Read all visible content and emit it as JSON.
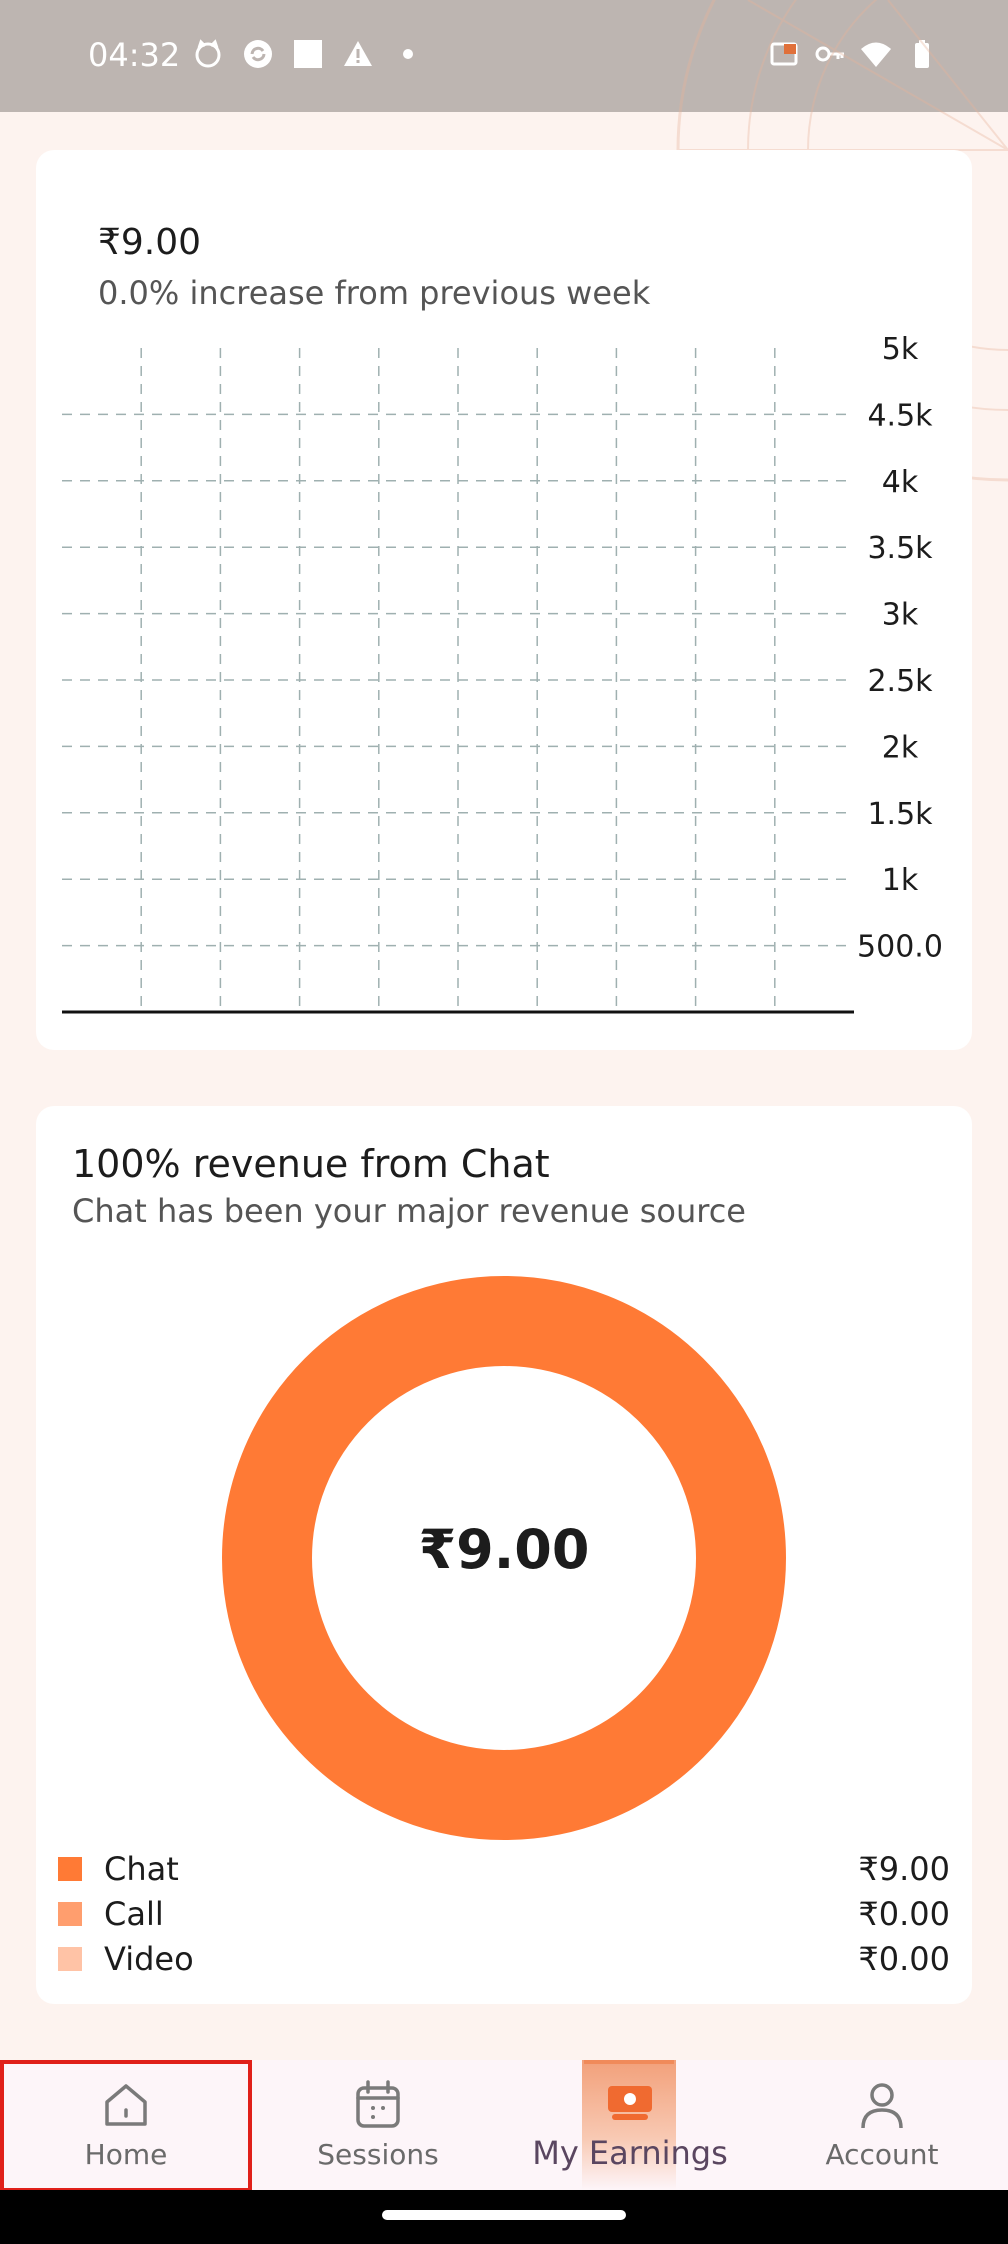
{
  "status_bar": {
    "time": "04:32",
    "left_icons": [
      "cat-icon",
      "sync-icon",
      "square-icon",
      "warning-icon",
      "dot-icon"
    ],
    "right_icons": [
      "cast-icon",
      "key-icon",
      "wifi-icon",
      "battery-icon"
    ]
  },
  "earnings_card": {
    "amount": "₹9.00",
    "subtitle": "0.0% increase from previous week",
    "chart_data": {
      "type": "bar",
      "categories": [],
      "values": [],
      "y_ticks": [
        "500.0",
        "1k",
        "1.5k",
        "2k",
        "2.5k",
        "3k",
        "3.5k",
        "4k",
        "4.5k",
        "5k"
      ],
      "ylim": [
        0,
        5000
      ],
      "grid": true
    }
  },
  "revenue_card": {
    "title": "100% revenue from Chat",
    "subtitle": "Chat has been your major revenue source",
    "center_amount": "₹9.00",
    "chart_data": {
      "type": "pie",
      "categories": [
        "Chat",
        "Call",
        "Video"
      ],
      "values": [
        9.0,
        0.0,
        0.0
      ],
      "colors": [
        "#ff7a35",
        "#ff9e6e",
        "#ffc3a6"
      ]
    },
    "legend": [
      {
        "label": "Chat",
        "value": "₹9.00",
        "color": "#ff7a35"
      },
      {
        "label": "Call",
        "value": "₹0.00",
        "color": "#ff9e6e"
      },
      {
        "label": "Video",
        "value": "₹0.00",
        "color": "#ffc3a6"
      }
    ]
  },
  "bottom_nav": {
    "items": [
      {
        "label": "Home",
        "icon": "home-icon"
      },
      {
        "label": "Sessions",
        "icon": "calendar-icon"
      },
      {
        "label": "My Earnings",
        "icon": "money-icon",
        "active": true
      },
      {
        "label": "Account",
        "icon": "person-icon"
      }
    ]
  }
}
